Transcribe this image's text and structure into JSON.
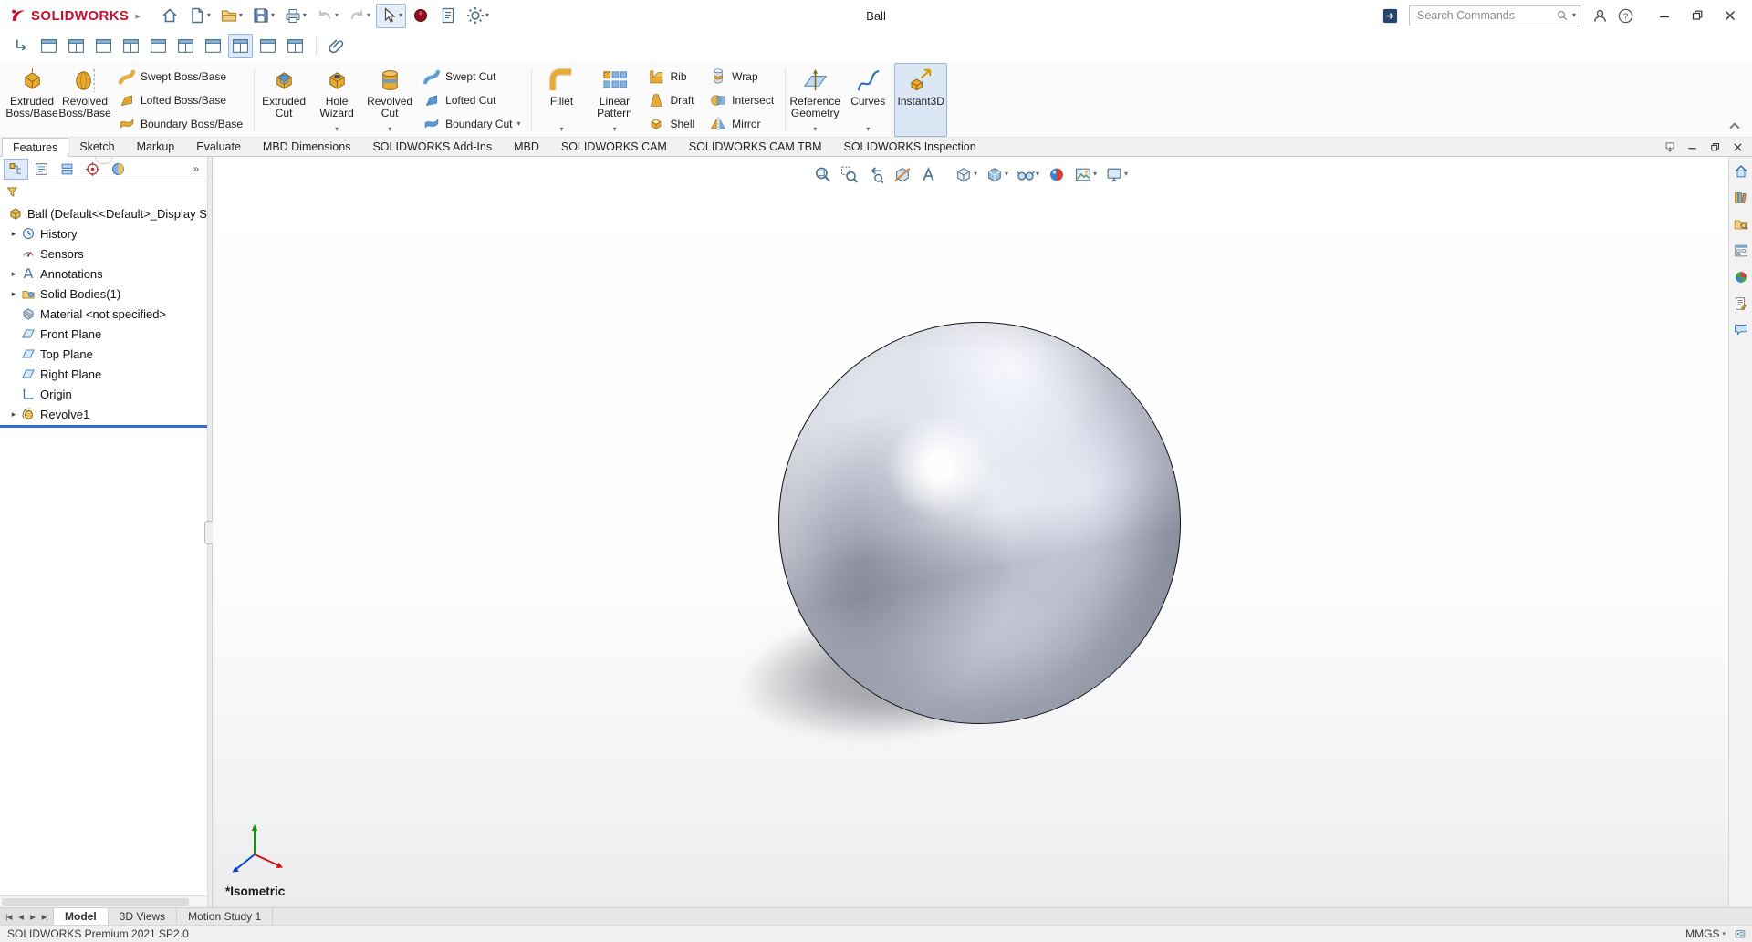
{
  "colors": {
    "accent_blue": "#2a6fd6",
    "brand_red": "#c8102e",
    "gold": "#e8aa30",
    "rollback_blue": "#2a6fd6"
  },
  "titlebar": {
    "brand": "SOLIDWORKS",
    "menu_arrow": "▸",
    "title": "Ball",
    "search": {
      "placeholder": "Search Commands",
      "caret": "▾"
    },
    "buttons": [
      {
        "name": "home",
        "icon": "home"
      },
      {
        "name": "new-document",
        "icon": "new-doc",
        "caret": true
      },
      {
        "name": "open",
        "icon": "open-folder",
        "caret": true
      },
      {
        "name": "save",
        "icon": "save",
        "caret": true
      },
      {
        "name": "print",
        "icon": "print",
        "caret": true
      },
      {
        "name": "undo",
        "icon": "undo",
        "caret": true,
        "disabled": true
      },
      {
        "name": "redo",
        "icon": "redo",
        "caret": true,
        "disabled": true
      },
      {
        "name": "select",
        "icon": "cursor",
        "caret": true,
        "active": true
      },
      {
        "name": "red-badge",
        "icon": "red-badge"
      },
      {
        "name": "file-properties",
        "icon": "file-props"
      },
      {
        "name": "options",
        "icon": "gear",
        "caret": true
      }
    ],
    "right_buttons": [
      {
        "name": "user-login",
        "icon": "person"
      },
      {
        "name": "help",
        "icon": "help"
      }
    ],
    "window_controls": [
      {
        "name": "minimize",
        "icon": "win-min"
      },
      {
        "name": "restore",
        "icon": "win-restore"
      },
      {
        "name": "close",
        "icon": "win-close"
      }
    ]
  },
  "view_toolbar": {
    "buttons": [
      {
        "name": "reorient-sketch",
        "icon": "corner-arrow"
      },
      {
        "name": "viewport-pane-1",
        "icon": "pane"
      },
      {
        "name": "viewport-pane-2",
        "icon": "pane2"
      },
      {
        "name": "viewport-pane-3",
        "icon": "pane"
      },
      {
        "name": "viewport-pane-4",
        "icon": "pane2"
      },
      {
        "name": "viewport-pane-5",
        "icon": "pane"
      },
      {
        "name": "viewport-pane-6",
        "icon": "pane2"
      },
      {
        "name": "viewport-pane-7",
        "icon": "pane"
      },
      {
        "name": "viewport-pane-8",
        "icon": "pane2",
        "active": true
      },
      {
        "name": "viewport-pane-9",
        "icon": "pane"
      },
      {
        "name": "viewport-pane-10",
        "icon": "pane2"
      },
      {
        "name": "attachment",
        "icon": "paperclip",
        "sep": true
      }
    ]
  },
  "ribbon": {
    "groups": [
      {
        "columns": [
          {
            "type": "big",
            "label": "Extruded Boss/Base",
            "icon": "f-extrude"
          },
          {
            "type": "big",
            "label": "Revolved Boss/Base",
            "icon": "f-revolve"
          },
          {
            "type": "stack",
            "items": [
              {
                "label": "Swept Boss/Base",
                "icon": "f-sweep"
              },
              {
                "label": "Lofted Boss/Base",
                "icon": "f-loft"
              },
              {
                "label": "Boundary Boss/Base",
                "icon": "f-boundary"
              }
            ]
          }
        ]
      },
      {
        "columns": [
          {
            "type": "big",
            "label": "Extruded Cut",
            "icon": "f-extrudecut"
          },
          {
            "type": "big",
            "label": "Hole Wizard",
            "icon": "f-holewizard",
            "caret": true
          },
          {
            "type": "big",
            "label": "Revolved Cut",
            "icon": "f-revolvecut",
            "caret": true
          },
          {
            "type": "stack",
            "items": [
              {
                "label": "Swept Cut",
                "icon": "f-sweepcut"
              },
              {
                "label": "Lofted Cut",
                "icon": "f-loftcut"
              },
              {
                "label": "Boundary Cut",
                "icon": "f-boundarycut",
                "caret": true
              }
            ]
          }
        ]
      },
      {
        "columns": [
          {
            "type": "big",
            "label": "Fillet",
            "icon": "f-fillet",
            "caret": true
          },
          {
            "type": "big",
            "label": "Linear Pattern",
            "icon": "f-pattern",
            "caret": true
          },
          {
            "type": "stack",
            "items": [
              {
                "label": "Rib",
                "icon": "f-rib"
              },
              {
                "label": "Draft",
                "icon": "f-draft"
              },
              {
                "label": "Shell",
                "icon": "f-shell"
              }
            ]
          },
          {
            "type": "stack",
            "items": [
              {
                "label": "Wrap",
                "icon": "f-wrap"
              },
              {
                "label": "Intersect",
                "icon": "f-intersect"
              },
              {
                "label": "Mirror",
                "icon": "f-mirror"
              }
            ]
          }
        ]
      },
      {
        "columns": [
          {
            "type": "big",
            "label": "Reference Geometry",
            "icon": "f-refgeo",
            "caret": true
          },
          {
            "type": "big",
            "label": "Curves",
            "icon": "f-curves",
            "caret": true
          },
          {
            "type": "big",
            "label": "Instant3D",
            "icon": "f-instant3d",
            "active": true
          }
        ]
      }
    ]
  },
  "command_tabs": {
    "tabs": [
      {
        "label": "Features",
        "active": true
      },
      {
        "label": "Sketch"
      },
      {
        "label": "Markup"
      },
      {
        "label": "Evaluate"
      },
      {
        "label": "MBD Dimensions"
      },
      {
        "label": "SOLIDWORKS Add-Ins"
      },
      {
        "label": "MBD"
      },
      {
        "label": "SOLIDWORKS CAM"
      },
      {
        "label": "SOLIDWORKS CAM TBM"
      },
      {
        "label": "SOLIDWORKS Inspection"
      }
    ],
    "window_controls": [
      {
        "name": "undock",
        "icon": "undock"
      },
      {
        "name": "minimize",
        "icon": "win-min"
      },
      {
        "name": "restore",
        "icon": "win-restore"
      },
      {
        "name": "close",
        "icon": "win-close"
      }
    ]
  },
  "panel": {
    "tabs": [
      {
        "name": "featuremanager",
        "icon": "pt-feature",
        "active": true
      },
      {
        "name": "propertymanager",
        "icon": "pt-property"
      },
      {
        "name": "configurationmanager",
        "icon": "pt-config"
      },
      {
        "name": "dimxpertmanager",
        "icon": "pt-dimxpert"
      },
      {
        "name": "displaymanager",
        "icon": "pt-display"
      },
      {
        "name": "tab-overflow",
        "glyph": "»"
      }
    ]
  },
  "feature_tree": {
    "root": {
      "label": "Ball  (Default<<Default>_Display State",
      "icon": "t-part"
    },
    "items": [
      {
        "label": "History",
        "icon": "t-history",
        "caret": true
      },
      {
        "label": "Sensors",
        "icon": "t-sensors"
      },
      {
        "label": "Annotations",
        "icon": "t-annot",
        "caret": true
      },
      {
        "label": "Solid Bodies(1)",
        "icon": "t-bodies",
        "caret": true
      },
      {
        "label": "Material <not specified>",
        "icon": "t-material"
      },
      {
        "label": "Front Plane",
        "icon": "t-plane"
      },
      {
        "label": "Top Plane",
        "icon": "t-plane"
      },
      {
        "label": "Right Plane",
        "icon": "t-plane"
      },
      {
        "label": "Origin",
        "icon": "t-origin"
      },
      {
        "label": "Revolve1",
        "icon": "t-revolve",
        "caret": true,
        "rollback_after": true
      }
    ]
  },
  "headsup": {
    "buttons": [
      {
        "name": "zoom-to-fit",
        "icon": "hu-zoomfit"
      },
      {
        "name": "zoom-to-area",
        "icon": "hu-zoomarea"
      },
      {
        "name": "previous-view",
        "icon": "hu-prev"
      },
      {
        "name": "section-view",
        "icon": "hu-section"
      },
      {
        "name": "dynamic-annotation-views",
        "icon": "hu-annot"
      },
      {
        "name": "view-orientation",
        "icon": "hu-cube",
        "caret": true,
        "sep": true
      },
      {
        "name": "display-style",
        "icon": "hu-display",
        "caret": true
      },
      {
        "name": "hide-show-items",
        "icon": "hu-eye",
        "caret": true
      },
      {
        "name": "edit-appearance",
        "icon": "hu-ball"
      },
      {
        "name": "apply-scene",
        "icon": "hu-scene",
        "caret": true
      },
      {
        "name": "view-settings",
        "icon": "hu-monitor",
        "caret": true
      }
    ]
  },
  "viewport": {
    "view_label": "*Isometric"
  },
  "task_pane": {
    "buttons": [
      {
        "name": "solidworks-resources",
        "icon": "tp-resources"
      },
      {
        "name": "design-library",
        "icon": "tp-library"
      },
      {
        "name": "file-explorer",
        "icon": "tp-explorer"
      },
      {
        "name": "view-palette",
        "icon": "tp-palette"
      },
      {
        "name": "appearances-scenes",
        "icon": "tp-appearance"
      },
      {
        "name": "custom-properties",
        "icon": "tp-props"
      },
      {
        "name": "forum",
        "icon": "tp-forum"
      }
    ]
  },
  "doc_tabs": {
    "nav": [
      "|◀",
      "◀",
      "▶",
      "▶|"
    ],
    "tabs": [
      {
        "label": "Model",
        "active": true
      },
      {
        "label": "3D Views"
      },
      {
        "label": "Motion Study 1"
      }
    ]
  },
  "statusbar": {
    "left": "SOLIDWORKS Premium 2021 SP2.0",
    "units": "MMGS",
    "units_caret": "▾"
  }
}
